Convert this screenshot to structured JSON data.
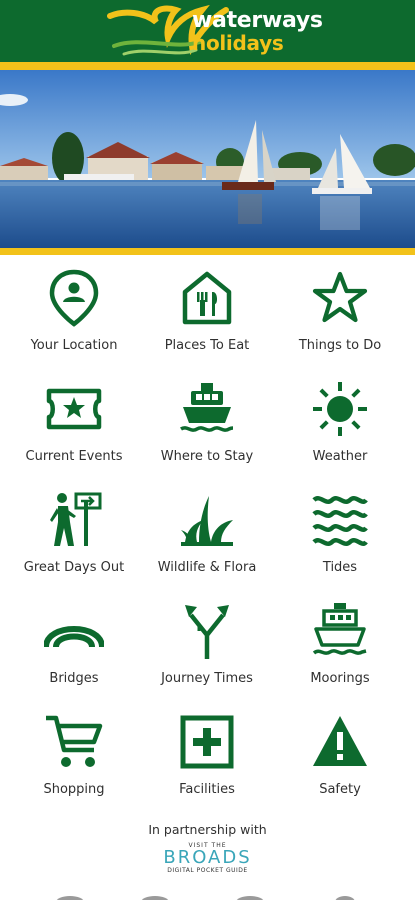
{
  "header": {
    "brand_line1": "waterways",
    "brand_line2": "holidays",
    "colors": {
      "green": "#0d6a2e",
      "yellow": "#f2c21a"
    }
  },
  "hero": {
    "image": "broads-river-sailing-boats-photo"
  },
  "menu": [
    {
      "label": "Your Location",
      "icon": "location-pin-icon"
    },
    {
      "label": "Places To Eat",
      "icon": "restaurant-icon"
    },
    {
      "label": "Things to Do",
      "icon": "star-icon"
    },
    {
      "label": "Current Events",
      "icon": "ticket-icon"
    },
    {
      "label": "Where to Stay",
      "icon": "boat-icon"
    },
    {
      "label": "Weather",
      "icon": "sun-icon"
    },
    {
      "label": "Great Days Out",
      "icon": "hiker-signpost-icon"
    },
    {
      "label": "Wildlife & Flora",
      "icon": "reeds-icon"
    },
    {
      "label": "Tides",
      "icon": "waves-icon"
    },
    {
      "label": "Bridges",
      "icon": "bridge-arch-icon"
    },
    {
      "label": "Journey Times",
      "icon": "fork-arrows-icon"
    },
    {
      "label": "Moorings",
      "icon": "moorings-boat-icon"
    },
    {
      "label": "Shopping",
      "icon": "cart-icon"
    },
    {
      "label": "Facilities",
      "icon": "first-aid-icon"
    },
    {
      "label": "Safety",
      "icon": "warning-icon"
    }
  ],
  "footer": {
    "partnership": "In partnership with",
    "broads_top": "VISIT THE",
    "broads_name": "BROADS",
    "broads_sub": "DIGITAL POCKET GUIDE"
  }
}
